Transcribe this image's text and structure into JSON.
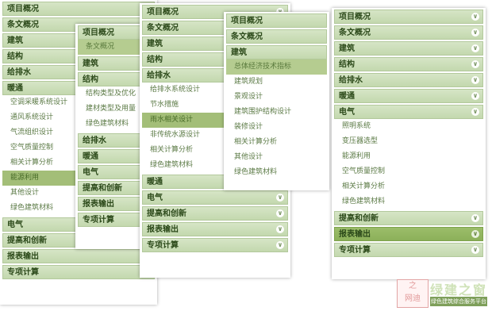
{
  "panel1": {
    "headers_top": [
      "项目概况",
      "条文概况",
      "建筑",
      "结构",
      "给排水",
      "暖通"
    ],
    "items": [
      "空调采暖系统设计",
      "通风系统设计",
      "气流组织设计",
      "空气质量控制",
      "相关计算分析",
      "能源利用",
      "其他设计",
      "绿色建筑材料"
    ],
    "selected_index": 5,
    "headers_bottom": [
      "电气",
      "提高和创新",
      "报表输出",
      "专项计算"
    ]
  },
  "panel2": {
    "headers_top": [
      "项目概况"
    ],
    "selected_top": "条文概况",
    "headers_mid": [
      "建筑",
      "结构"
    ],
    "items": [
      "结构类型及优化",
      "建材类型及用量",
      "绿色建筑材料"
    ],
    "headers_bottom": [
      "给排水",
      "暖通",
      "电气",
      "提高和创新",
      "报表输出",
      "专项计算"
    ]
  },
  "panel3": {
    "headers_top": [
      "项目概况",
      "条文概况",
      "建筑",
      "结构",
      "给排水"
    ],
    "items": [
      "给排水系统设计",
      "节水措施",
      "雨水相关设计",
      "非传统水源设计",
      "相关计算分析",
      "绿色建筑材料"
    ],
    "selected_index": 2,
    "headers_bottom": [
      "暖通",
      "电气",
      "提高和创新",
      "报表输出",
      "专项计算"
    ]
  },
  "panel4": {
    "headers_top": [
      "项目概况",
      "条文概况",
      "建筑"
    ],
    "items": [
      "总体经济技术指标",
      "建筑规划",
      "景观设计",
      "建筑围护结构设计",
      "装修设计",
      "相关计算分析",
      "其他设计",
      "绿色建筑材料"
    ],
    "selected_index": 0
  },
  "panel5": {
    "headers_top": [
      "项目概况",
      "条文概况",
      "建筑",
      "结构",
      "给排水",
      "暖通",
      "电气"
    ],
    "items": [
      "照明系统",
      "变压器选型",
      "能源利用",
      "空气质量控制",
      "相关计算分析",
      "绿色建筑材料"
    ],
    "headers_bottom": [
      "提高和创新",
      "报表输出",
      "专项计算"
    ],
    "active_bottom_index": 1
  },
  "icons": {
    "chevron": "chevron-down-icon"
  },
  "watermark": {
    "logo_top": "之",
    "logo_bottom": "网迪",
    "title": "绿建之窗",
    "subtitle": "绿色建筑综合服务平台"
  },
  "colors": {
    "header_bg": "#c8dbb3",
    "selected_bg": "#a3be78",
    "text_green": "#5b7a45"
  }
}
